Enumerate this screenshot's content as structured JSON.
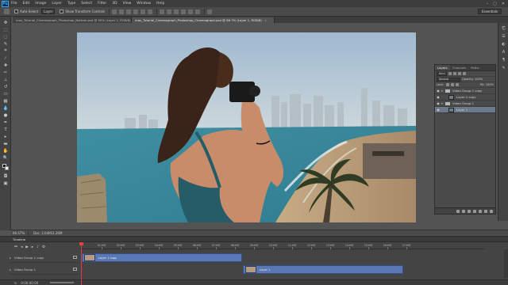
{
  "menubar": {
    "logo": "Ps",
    "items": [
      "File",
      "Edit",
      "Image",
      "Layer",
      "Type",
      "Select",
      "Filter",
      "3D",
      "View",
      "Window",
      "Help"
    ],
    "win_controls": [
      "–",
      "▢",
      "✕"
    ]
  },
  "options": {
    "auto_select_label": "Auto-Select",
    "auto_select_value": "Layer",
    "transform_label": "Show Transform Controls",
    "workspace": "Essentials"
  },
  "tabs": [
    {
      "label": "mov_Tutorial_Cinemagraph_Photoshop_Bottom.psd @ 50% (Layer 1, RGB/8)",
      "active": false
    },
    {
      "label": "mov_Tutorial_Cinemagraph_Photoshop_Cinemagraph.psd @ 66.7% (Layer 1, RGB/8)",
      "active": true
    }
  ],
  "status": {
    "zoom": "66.67%",
    "doc": "Doc: 2.64M/3.26M"
  },
  "layers_panel": {
    "tabs": [
      "Layers",
      "Channels",
      "Paths"
    ],
    "kind_label": "Kind",
    "blend_mode": "Normal",
    "opacity_label": "Opacity: 100%",
    "lock_label": "Lock:",
    "fill_label": "Fill: 100%",
    "layers": [
      {
        "name": "Video Group 1 copy",
        "type": "group",
        "indent": 0,
        "selected": false
      },
      {
        "name": "Layer 1 copy",
        "type": "layer",
        "indent": 1,
        "selected": false
      },
      {
        "name": "Video Group 1",
        "type": "group",
        "indent": 0,
        "selected": false
      },
      {
        "name": "Layer 1",
        "type": "layer",
        "indent": 1,
        "selected": true
      }
    ]
  },
  "timeline": {
    "title": "Timeline",
    "ruler": [
      "01:00f",
      "02:00f",
      "03:00f",
      "04:00f",
      "05:00f",
      "06:00f",
      "07:00f",
      "08:00f",
      "09:00f",
      "10:00f",
      "11:00f",
      "12:00f",
      "13:00f",
      "14:00f",
      "15:00f",
      "16:00f",
      "17:00f"
    ],
    "tracks": [
      {
        "name": "Video Group 1 copy"
      },
      {
        "name": "Video Group 1"
      }
    ],
    "clips": [
      {
        "label": "Layer 1 copy"
      },
      {
        "label": "Layer 1"
      }
    ],
    "footer_time": "0:00:00:00"
  }
}
